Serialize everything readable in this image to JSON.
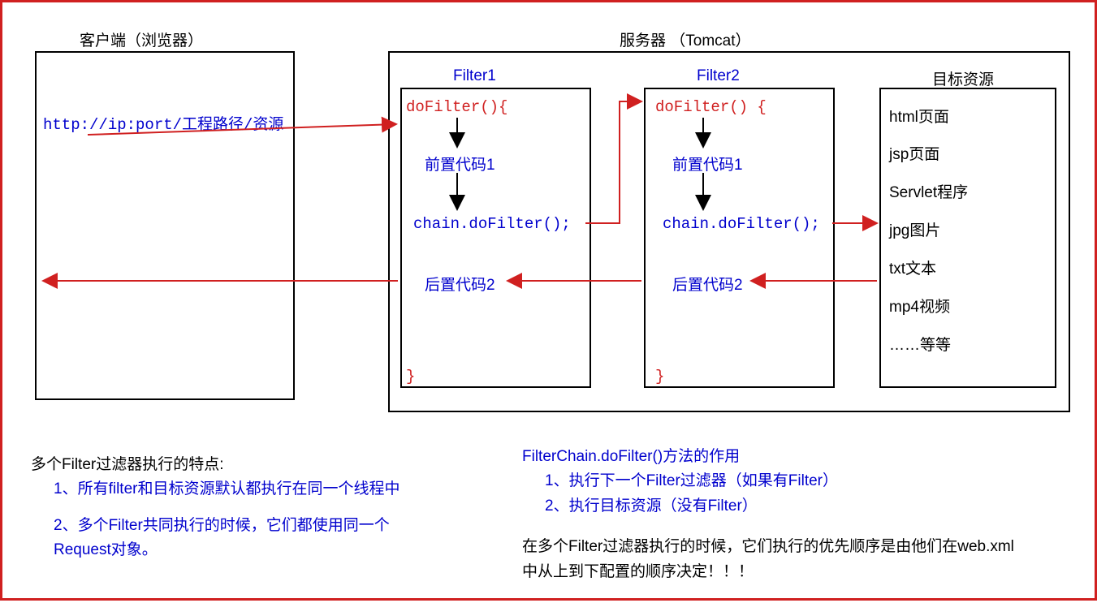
{
  "client": {
    "title": "客户端（浏览器）",
    "url": "http://ip:port/工程路径/资源"
  },
  "server": {
    "title": "服务器 （Tomcat）",
    "filter1": {
      "title": "Filter1",
      "sig_open": "doFilter(){",
      "pre": "前置代码1",
      "chain": "chain.doFilter();",
      "post": "后置代码2",
      "close": "}"
    },
    "filter2": {
      "title": "Filter2",
      "sig_open": "doFilter() {",
      "pre": "前置代码1",
      "chain": "chain.doFilter();",
      "post": "后置代码2",
      "close": "}"
    },
    "target": {
      "title": "目标资源",
      "items": [
        "html页面",
        "jsp页面",
        "Servlet程序",
        "jpg图片",
        "txt文本",
        "mp4视频",
        "……等等"
      ]
    }
  },
  "notes_left": {
    "heading": "多个Filter过滤器执行的特点:",
    "p1": "1、所有filter和目标资源默认都执行在同一个线程中",
    "p2": "2、多个Filter共同执行的时候，它们都使用同一个Request对象。"
  },
  "notes_right": {
    "heading": "FilterChain.doFilter()方法的作用",
    "p1": "1、执行下一个Filter过滤器（如果有Filter）",
    "p2": "2、执行目标资源（没有Filter）",
    "footer": "在多个Filter过滤器执行的时候，它们执行的优先顺序是由他们在web.xml中从上到下配置的顺序决定！！！"
  }
}
